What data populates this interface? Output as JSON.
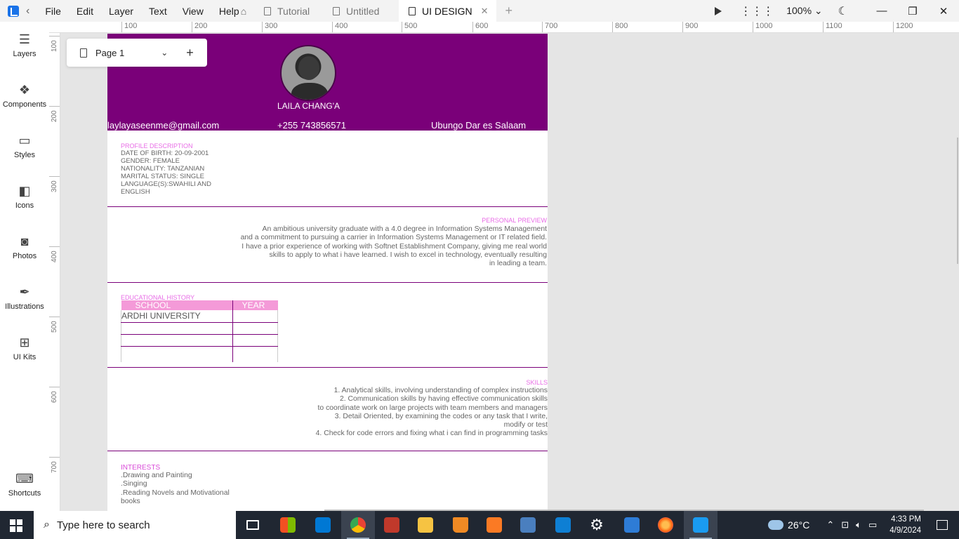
{
  "menu": [
    "File",
    "Edit",
    "Layer",
    "Text",
    "View",
    "Help"
  ],
  "tabs": [
    {
      "label": "Tutorial",
      "active": false
    },
    {
      "label": "Untitled",
      "active": false
    },
    {
      "label": "UI DESIGN",
      "active": true
    }
  ],
  "toolbar": {
    "zoom": "100%"
  },
  "sidebar": {
    "items": [
      "Layers",
      "Components",
      "Styles",
      "Icons",
      "Photos",
      "Illustrations",
      "UI Kits"
    ],
    "shortcuts": "Shortcuts"
  },
  "rulers": {
    "top": [
      "100",
      "200",
      "300",
      "400",
      "500",
      "600",
      "700",
      "800",
      "900",
      "1000",
      "1100",
      "1200"
    ],
    "left": [
      "100",
      "200",
      "300",
      "400",
      "500",
      "600",
      "700"
    ]
  },
  "page_selector": {
    "label": "Page 1"
  },
  "resume": {
    "name": "LAILA CHANG'A",
    "email": "laylayaseenme@gmail.com",
    "phone": "+255 743856571",
    "location": "Ubungo Dar es Salaam",
    "profile": {
      "title": "PROFILE DESCRIPTION",
      "lines": [
        "DATE OF BIRTH: 20-09-2001",
        "GENDER: FEMALE",
        "NATIONALITY: TANZANIAN",
        "MARITAL STATUS: SINGLE",
        "LANGUAGE(S):SWAHILI AND",
        "ENGLISH"
      ]
    },
    "preview": {
      "title": "PERSONAL PREVIEW",
      "lines": [
        "An ambitious university graduate with a 4.0 degree in Information Systems Management",
        "and a commitment to pursuing a carrier in Information Systems Management or IT related field.",
        "I have a prior experience of working with Softnet Establishment Company, giving me real world",
        "skills to apply to what i have learned. I wish to excel in technology, eventually resulting",
        "in leading a team."
      ]
    },
    "education": {
      "title": "EDUCATIONAL HISTORY",
      "headers": [
        "SCHOOL",
        "YEAR"
      ],
      "rows": [
        [
          "ARDHI UNIVERSITY",
          ""
        ],
        [
          "",
          ""
        ],
        [
          "",
          ""
        ],
        [
          "",
          ""
        ]
      ]
    },
    "skills": {
      "title": "SKILLS",
      "lines": [
        "1. Analytical skills, involving understanding of complex instructions",
        "2. Communication skills by having effective communication skills",
        "to coordinate work on large projects with team members and managers",
        "3. Detail Oriented, by examining the codes or any task that I write,",
        "modify or test",
        "4. Check for code errors and fixing what i can find in programming tasks"
      ]
    },
    "interests": {
      "title": "INTERESTS",
      "lines": [
        ".Drawing and Painting",
        ".Singing",
        ".Reading Novels and Motivational",
        "books"
      ]
    }
  },
  "taskbar": {
    "search_placeholder": "Type here to search",
    "weather": "26°C",
    "time": "4:33 PM",
    "date": "4/9/2024"
  },
  "colors": {
    "header": "#7a0079",
    "accent_pink": "#f49ad8",
    "section_title": "#e86ce6"
  }
}
